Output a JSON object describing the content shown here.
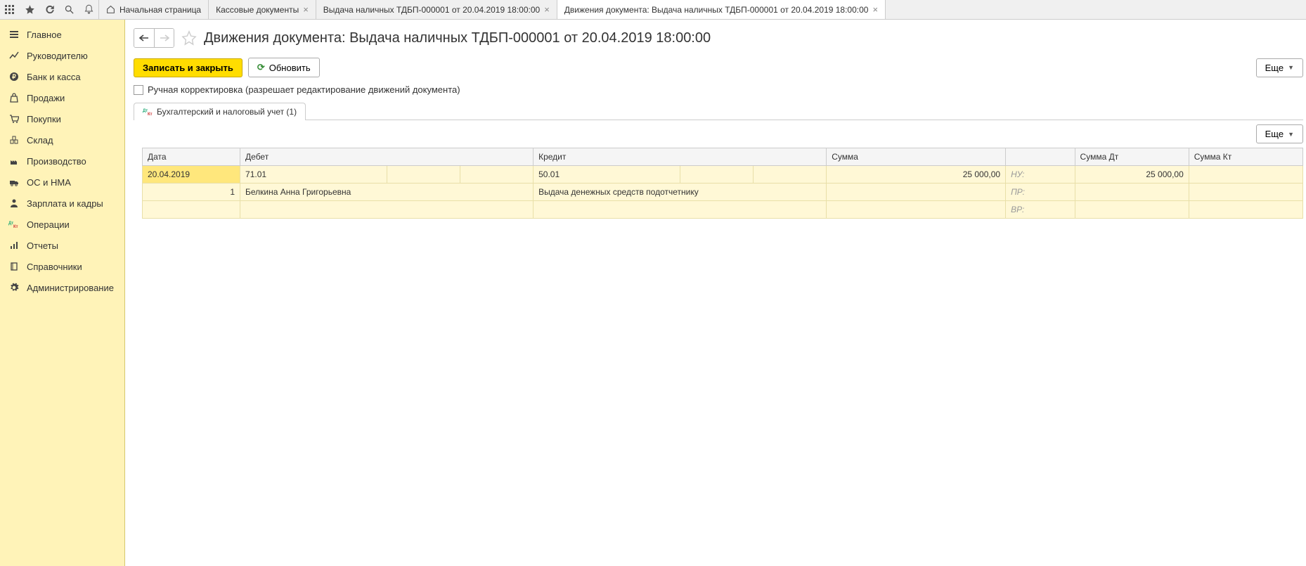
{
  "topTabs": {
    "home": "Начальная страница",
    "t1": "Кассовые документы",
    "t2": "Выдача наличных ТДБП-000001 от 20.04.2019 18:00:00",
    "t3": "Движения документа: Выдача наличных ТДБП-000001 от 20.04.2019 18:00:00"
  },
  "sidebar": {
    "main": "Главное",
    "manager": "Руководителю",
    "bank": "Банк и касса",
    "sales": "Продажи",
    "purchases": "Покупки",
    "warehouse": "Склад",
    "production": "Производство",
    "assets": "ОС и НМА",
    "salary": "Зарплата и кадры",
    "operations": "Операции",
    "reports": "Отчеты",
    "catalogs": "Справочники",
    "admin": "Администрирование"
  },
  "header": {
    "title": "Движения документа: Выдача наличных ТДБП-000001 от 20.04.2019 18:00:00"
  },
  "toolbar": {
    "saveClose": "Записать и закрыть",
    "refresh": "Обновить",
    "more": "Еще"
  },
  "checkbox": {
    "label": "Ручная корректировка (разрешает редактирование движений документа)"
  },
  "innerTab": {
    "label": "Бухгалтерский и налоговый учет (1)"
  },
  "gridHeaders": {
    "date": "Дата",
    "debit": "Дебет",
    "credit": "Кредит",
    "sum": "Сумма",
    "sumDt": "Сумма Дт",
    "sumKt": "Сумма Кт"
  },
  "gridRow": {
    "date": "20.04.2019",
    "rowNum": "1",
    "debitAcc": "71.01",
    "debitName": "Белкина Анна Григорьевна",
    "creditAcc": "50.01",
    "creditName": "Выдача денежных средств подотчетнику",
    "sum": "25 000,00",
    "nuLabel": "НУ:",
    "prLabel": "ПР:",
    "vrLabel": "ВР:",
    "sumDt": "25 000,00"
  }
}
